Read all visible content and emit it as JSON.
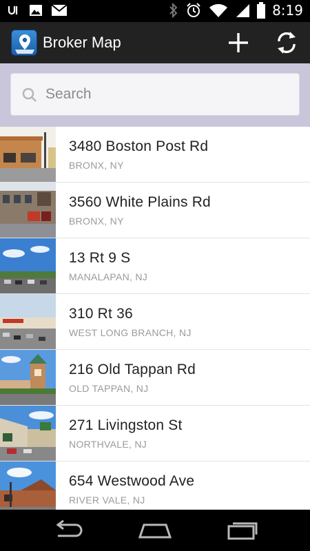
{
  "status_bar": {
    "time": "8:19",
    "icons": [
      "usb-debug-icon",
      "image-icon",
      "gmail-icon",
      "bluetooth-icon",
      "alarm-icon",
      "wifi-icon",
      "signal-icon",
      "battery-icon"
    ]
  },
  "action_bar": {
    "title": "Broker Map",
    "actions": [
      "add-icon",
      "refresh-icon"
    ]
  },
  "search": {
    "placeholder": "Search",
    "value": ""
  },
  "listings": [
    {
      "address": "3480 Boston Post Rd",
      "city": "BRONX, NY"
    },
    {
      "address": "3560 White Plains Rd",
      "city": "BRONX, NY"
    },
    {
      "address": "13 Rt 9 S",
      "city": "MANALAPAN, NJ"
    },
    {
      "address": "310 Rt 36",
      "city": "WEST LONG BRANCH, NJ"
    },
    {
      "address": "216 Old Tappan Rd",
      "city": "OLD TAPPAN, NJ"
    },
    {
      "address": "271 Livingston St",
      "city": "NORTHVALE, NJ"
    },
    {
      "address": "654 Westwood Ave",
      "city": "RIVER VALE, NJ"
    }
  ],
  "nav_bar": [
    "back-icon",
    "home-icon",
    "recents-icon"
  ],
  "colors": {
    "action_bar": "#222222",
    "search_bg": "#c9c6dc",
    "list_bg": "#ffffff"
  }
}
